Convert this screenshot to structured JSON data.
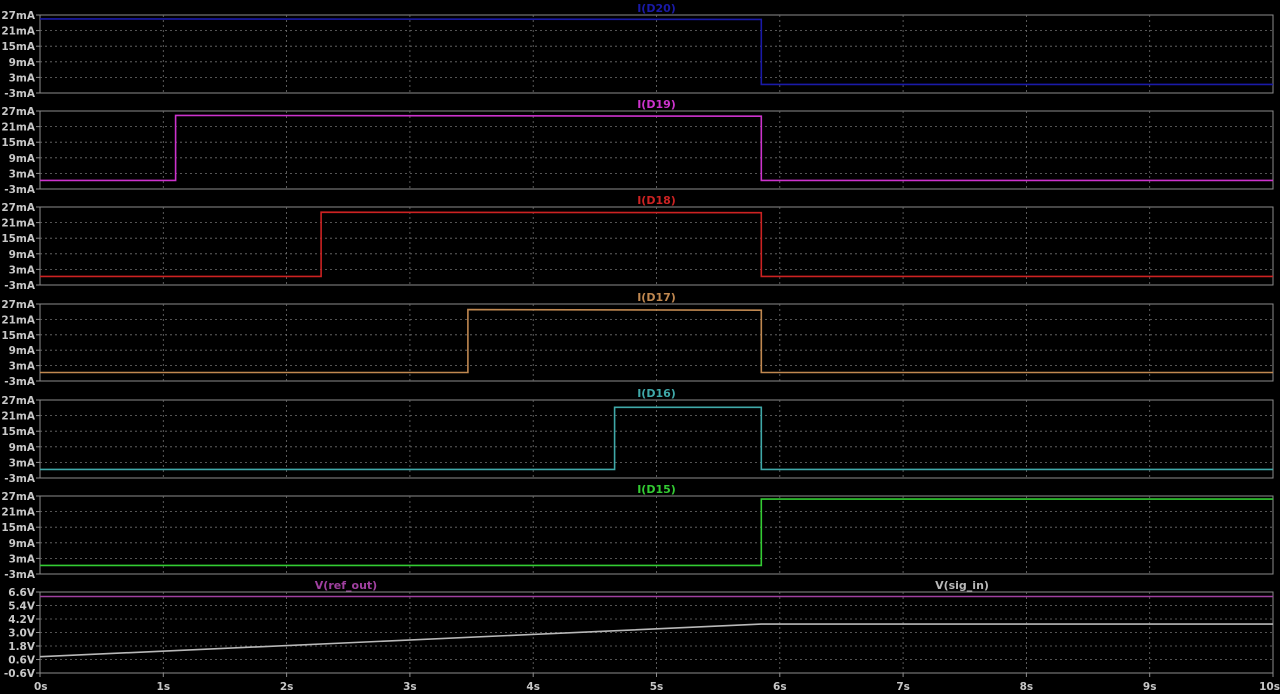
{
  "chart_data": {
    "type": "line",
    "x_ticks": [
      "0s",
      "1s",
      "2s",
      "3s",
      "4s",
      "5s",
      "6s",
      "7s",
      "8s",
      "9s",
      "10s"
    ],
    "xlim": [
      0,
      10
    ],
    "grid": true,
    "panes": [
      {
        "unit": "mA",
        "ylim": [
          -3,
          27
        ],
        "y_ticks": [
          "27mA",
          "21mA",
          "15mA",
          "9mA",
          "3mA",
          "-3mA"
        ],
        "series": [
          {
            "name": "I(D20)",
            "color": "#1a1aa8",
            "x": [
              0,
              5.85,
              5.85,
              10
            ],
            "y": [
              25.5,
              25.3,
              0.3,
              0.3
            ]
          }
        ]
      },
      {
        "unit": "mA",
        "ylim": [
          -3,
          27
        ],
        "y_ticks": [
          "27mA",
          "21mA",
          "15mA",
          "9mA",
          "3mA",
          "-3mA"
        ],
        "series": [
          {
            "name": "I(D19)",
            "color": "#cc33cc",
            "x": [
              0,
              1.1,
              1.1,
              5.85,
              5.85,
              10
            ],
            "y": [
              0.3,
              0.3,
              25.3,
              25.0,
              0.3,
              0.3
            ]
          }
        ]
      },
      {
        "unit": "mA",
        "ylim": [
          -3,
          27
        ],
        "y_ticks": [
          "27mA",
          "21mA",
          "15mA",
          "9mA",
          "3mA",
          "-3mA"
        ],
        "series": [
          {
            "name": "I(D18)",
            "color": "#cc2222",
            "x": [
              0,
              2.28,
              2.28,
              5.85,
              5.85,
              10
            ],
            "y": [
              0.3,
              0.3,
              25.0,
              24.8,
              0.3,
              0.3
            ]
          }
        ]
      },
      {
        "unit": "mA",
        "ylim": [
          -3,
          27
        ],
        "y_ticks": [
          "27mA",
          "21mA",
          "15mA",
          "9mA",
          "3mA",
          "-3mA"
        ],
        "series": [
          {
            "name": "I(D17)",
            "color": "#c08850",
            "x": [
              0,
              3.47,
              3.47,
              5.85,
              5.85,
              10
            ],
            "y": [
              0.3,
              0.3,
              24.8,
              24.6,
              0.3,
              0.3
            ]
          }
        ]
      },
      {
        "unit": "mA",
        "ylim": [
          -3,
          27
        ],
        "y_ticks": [
          "27mA",
          "21mA",
          "15mA",
          "9mA",
          "3mA",
          "-3mA"
        ],
        "series": [
          {
            "name": "I(D16)",
            "color": "#3fa8a8",
            "x": [
              0,
              4.66,
              4.66,
              5.85,
              5.85,
              10
            ],
            "y": [
              0.3,
              0.3,
              24.2,
              24.2,
              0.3,
              0.3
            ]
          }
        ]
      },
      {
        "unit": "mA",
        "ylim": [
          -3,
          27
        ],
        "y_ticks": [
          "27mA",
          "21mA",
          "15mA",
          "9mA",
          "3mA",
          "-3mA"
        ],
        "series": [
          {
            "name": "I(D15)",
            "color": "#33cc33",
            "x": [
              0,
              5.85,
              5.85,
              10
            ],
            "y": [
              0.3,
              0.3,
              25.8,
              25.8
            ]
          }
        ]
      },
      {
        "unit": "V",
        "ylim": [
          -0.6,
          6.6
        ],
        "y_ticks": [
          "6.6V",
          "5.4V",
          "4.2V",
          "3.0V",
          "1.8V",
          "0.6V",
          "-0.6V"
        ],
        "series": [
          {
            "name": "V(ref_out)",
            "color": "#a040a0",
            "x": [
              0,
              10
            ],
            "y": [
              6.2,
              6.2
            ]
          },
          {
            "name": "V(sig_in)",
            "color": "#b8b8b8",
            "x": [
              0,
              5.85,
              10
            ],
            "y": [
              0.85,
              3.75,
              3.75
            ]
          }
        ]
      }
    ]
  }
}
